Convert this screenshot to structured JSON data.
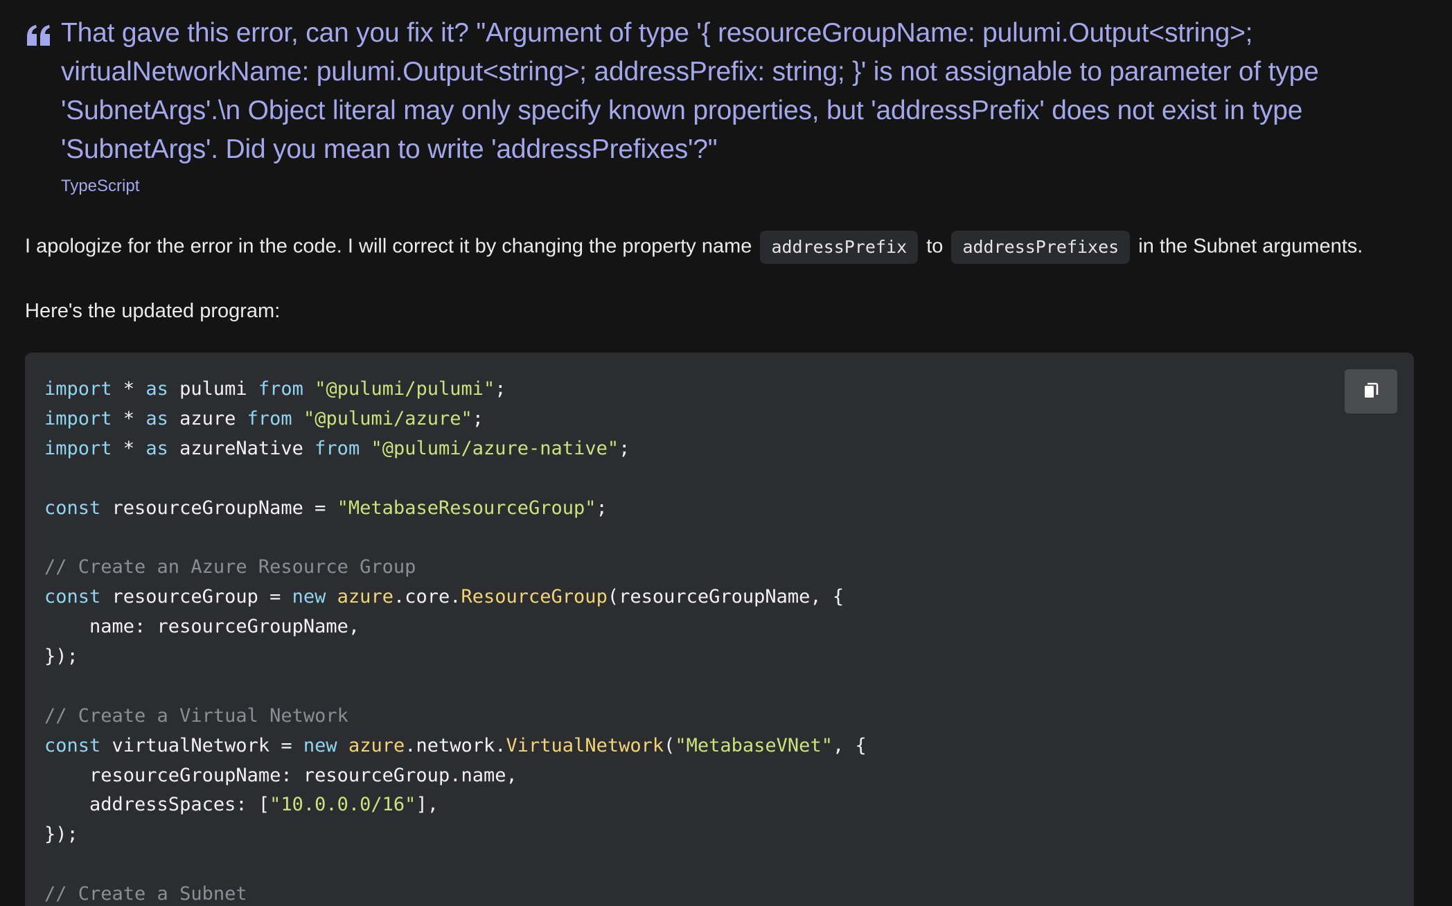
{
  "question": {
    "text": "That gave this error, can you fix it? \"Argument of type '{ resourceGroupName: pulumi.Output<string>; virtualNetworkName: pulumi.Output<string>; addressPrefix: string; }' is not assignable to parameter of type 'SubnetArgs'.\\n Object literal may only specify known properties, but 'addressPrefix' does not exist in type 'SubnetArgs'. Did you mean to write 'addressPrefixes'?\"",
    "language_tag": "TypeScript",
    "icon": "quote-icon"
  },
  "answer": {
    "intro_before": "I apologize for the error in the code. I will correct it by changing the property name",
    "code_old": "addressPrefix",
    "intro_middle": "to",
    "code_new": "addressPrefixes",
    "intro_after": "in the Subnet arguments.",
    "lead_in": "Here's the updated program:"
  },
  "code_block": {
    "copy_icon": "clipboard-icon",
    "lines": [
      [
        [
          "kw",
          "import"
        ],
        [
          "pl",
          " * "
        ],
        [
          "kw",
          "as"
        ],
        [
          "pl",
          " pulumi "
        ],
        [
          "kw",
          "from"
        ],
        [
          "pl",
          " "
        ],
        [
          "str",
          "\"@pulumi/pulumi\""
        ],
        [
          "pl",
          ";"
        ]
      ],
      [
        [
          "kw",
          "import"
        ],
        [
          "pl",
          " * "
        ],
        [
          "kw",
          "as"
        ],
        [
          "pl",
          " azure "
        ],
        [
          "kw",
          "from"
        ],
        [
          "pl",
          " "
        ],
        [
          "str",
          "\"@pulumi/azure\""
        ],
        [
          "pl",
          ";"
        ]
      ],
      [
        [
          "kw",
          "import"
        ],
        [
          "pl",
          " * "
        ],
        [
          "kw",
          "as"
        ],
        [
          "pl",
          " azureNative "
        ],
        [
          "kw",
          "from"
        ],
        [
          "pl",
          " "
        ],
        [
          "str",
          "\"@pulumi/azure-native\""
        ],
        [
          "pl",
          ";"
        ]
      ],
      [],
      [
        [
          "kw",
          "const"
        ],
        [
          "pl",
          " resourceGroupName = "
        ],
        [
          "str",
          "\"MetabaseResourceGroup\""
        ],
        [
          "pl",
          ";"
        ]
      ],
      [],
      [
        [
          "cm",
          "// Create an Azure Resource Group"
        ]
      ],
      [
        [
          "kw",
          "const"
        ],
        [
          "pl",
          " resourceGroup = "
        ],
        [
          "kw",
          "new"
        ],
        [
          "pl",
          " "
        ],
        [
          "fn",
          "azure"
        ],
        [
          "pl",
          ".core."
        ],
        [
          "fn",
          "ResourceGroup"
        ],
        [
          "pl",
          "(resourceGroupName, {"
        ]
      ],
      [
        [
          "pl",
          "    name: resourceGroupName,"
        ]
      ],
      [
        [
          "pl",
          "});"
        ]
      ],
      [],
      [
        [
          "cm",
          "// Create a Virtual Network"
        ]
      ],
      [
        [
          "kw",
          "const"
        ],
        [
          "pl",
          " virtualNetwork = "
        ],
        [
          "kw",
          "new"
        ],
        [
          "pl",
          " "
        ],
        [
          "fn",
          "azure"
        ],
        [
          "pl",
          ".network."
        ],
        [
          "fn",
          "VirtualNetwork"
        ],
        [
          "pl",
          "("
        ],
        [
          "str",
          "\"MetabaseVNet\""
        ],
        [
          "pl",
          ", {"
        ]
      ],
      [
        [
          "pl",
          "    resourceGroupName: resourceGroup.name,"
        ]
      ],
      [
        [
          "pl",
          "    addressSpaces: ["
        ],
        [
          "str",
          "\"10.0.0.0/16\""
        ],
        [
          "pl",
          "],"
        ]
      ],
      [
        [
          "pl",
          "});"
        ]
      ],
      [],
      [
        [
          "cm",
          "// Create a Subnet"
        ]
      ]
    ]
  }
}
